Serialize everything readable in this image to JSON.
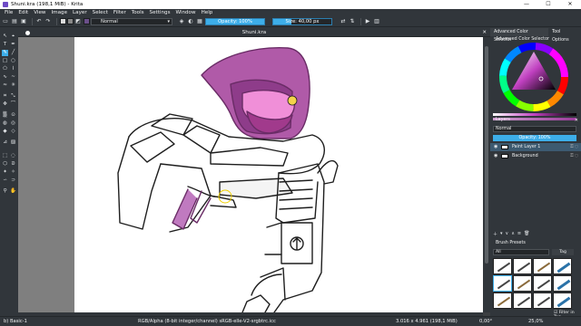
{
  "window": {
    "title": "Shuni.kra (198,1 MiB)  - Krita",
    "minimize": "—",
    "maximize": "☐",
    "close": "✕"
  },
  "menu": [
    "File",
    "Edit",
    "View",
    "Image",
    "Layer",
    "Select",
    "Filter",
    "Tools",
    "Settings",
    "Window",
    "Help"
  ],
  "toolbar": {
    "blend_mode": "Normal",
    "opacity_label": "Opacity: 100%",
    "size_label": "Size: 40,00 px"
  },
  "document": {
    "tab_title": "Shuni.kra",
    "close": "✕"
  },
  "dock": {
    "tabs": [
      "Advanced Color Selector",
      "Tool Options"
    ],
    "color_selector_title": "Advanced Color Selector",
    "layers_title": "Layers",
    "layer_blend": "Normal",
    "layer_opacity": "Opacity:  100%",
    "layers": [
      {
        "name": "Paint Layer 1",
        "selected": true
      },
      {
        "name": "Background",
        "selected": false
      }
    ],
    "brush_presets_title": "Brush Presets",
    "preset_filter": "All",
    "preset_tag": "Tag",
    "filter_in_tag": "Filter in Tag"
  },
  "status": {
    "preset": "b) Basic-1",
    "color_info": "RGB/Alpha (8-bit integer/channel)  sRGB-elle-V2-srgbtrc.icc",
    "dims": "3.016 x 4.961 (198,1 MiB)",
    "rotation": "0,00°",
    "zoom": "25,0%"
  },
  "colors": {
    "accent": "#3daee9",
    "bg": "#31363b",
    "hood": "#b05aa8",
    "hood_dark": "#8e3c8a",
    "mask": "#f08fd8",
    "paper": "#ffffff"
  }
}
